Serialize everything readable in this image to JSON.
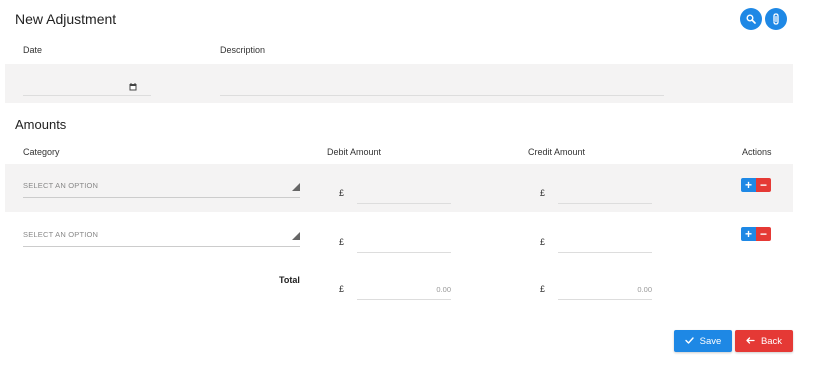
{
  "header": {
    "title": "New Adjustment",
    "search_icon": "search-icon",
    "attach_icon": "paperclip-icon"
  },
  "adjustment": {
    "date_label": "Date",
    "date_value": "",
    "description_label": "Description",
    "description_value": "",
    "calendar_icon": "calendar-icon"
  },
  "amounts": {
    "title": "Amounts",
    "columns": {
      "category": "Category",
      "debit": "Debit Amount",
      "credit": "Credit Amount",
      "actions": "Actions"
    },
    "rows": [
      {
        "category": "SELECT AN OPTION",
        "currency": "£",
        "debit": "",
        "credit": ""
      },
      {
        "category": "SELECT AN OPTION",
        "currency": "£",
        "debit": "",
        "credit": ""
      }
    ],
    "total": {
      "label": "Total",
      "currency": "£",
      "debit": "0.00",
      "credit": "0.00"
    },
    "add_symbol": "+",
    "remove_symbol": "−"
  },
  "footer": {
    "save_label": "Save",
    "back_label": "Back"
  },
  "colors": {
    "primary": "#1e88e5",
    "danger": "#e53935",
    "band": "#f4f3f3"
  }
}
